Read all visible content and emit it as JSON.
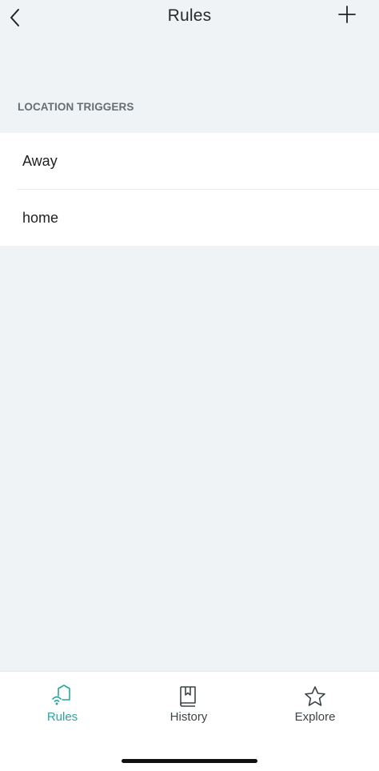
{
  "header": {
    "title": "Rules",
    "back_icon": "chevron-left-icon",
    "add_icon": "plus-icon"
  },
  "section": {
    "title": "LOCATION TRIGGERS"
  },
  "list": {
    "items": [
      {
        "label": "Away"
      },
      {
        "label": "home"
      }
    ]
  },
  "tabbar": {
    "tabs": [
      {
        "label": "Rules",
        "icon": "home-wifi-icon",
        "active": true
      },
      {
        "label": "History",
        "icon": "book-icon",
        "active": false
      },
      {
        "label": "Explore",
        "icon": "star-icon",
        "active": false
      }
    ]
  },
  "colors": {
    "background": "#eff3f6",
    "accent": "#27a7a0",
    "surface": "#ffffff",
    "section_text": "#666d73"
  }
}
